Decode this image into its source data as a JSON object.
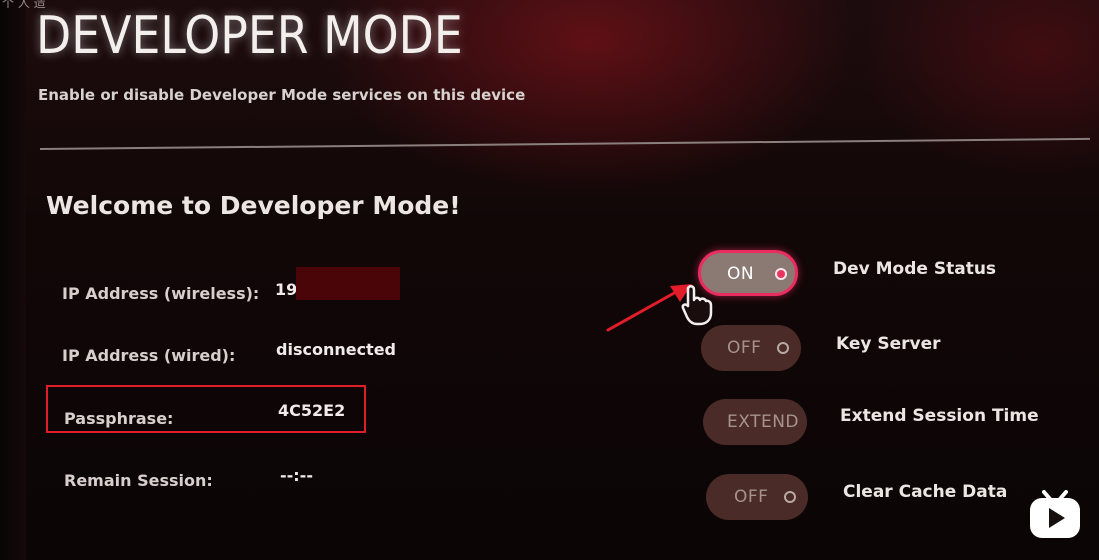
{
  "screen": {
    "corner_mark": "个 人 造",
    "title": "DEVELOPER MODE",
    "subtitle": "Enable or disable Developer Mode services on this device",
    "welcome": "Welcome to Developer Mode!"
  },
  "info": {
    "wireless": {
      "label": "IP Address (wireless):",
      "value": "19"
    },
    "wired": {
      "label": "IP Address (wired):",
      "value": "disconnected"
    },
    "passphrase": {
      "label": "Passphrase:",
      "value": "4C52E2"
    },
    "session": {
      "label": "Remain Session:",
      "value": "--:--"
    }
  },
  "controls": {
    "dev_mode": {
      "button": "ON",
      "label": "Dev Mode Status",
      "state": "on"
    },
    "key_server": {
      "button": "OFF",
      "label": "Key Server",
      "state": "off"
    },
    "extend": {
      "button": "EXTEND",
      "label": "Extend Session Time"
    },
    "clear_cache": {
      "button": "OFF",
      "label": "Clear Cache Data",
      "state": "off"
    }
  },
  "colors": {
    "accent": "#ea2c60",
    "annotation_red": "#e21d2a",
    "toggle_bg": "#4a2b27"
  },
  "icons": {
    "cursor": "hand-pointer-icon",
    "annotation": "red-arrow-icon",
    "watermark": "tv-logo-icon"
  }
}
